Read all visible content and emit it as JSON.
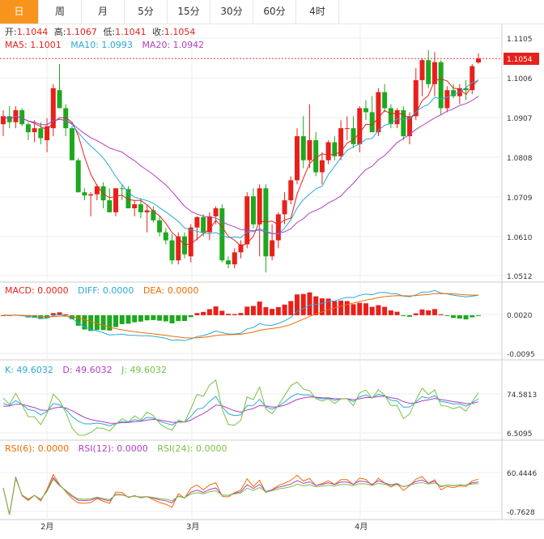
{
  "tabs": [
    {
      "label": "日",
      "active": true
    },
    {
      "label": "周",
      "active": false
    },
    {
      "label": "月",
      "active": false
    },
    {
      "label": "5分",
      "active": false
    },
    {
      "label": "15分",
      "active": false
    },
    {
      "label": "30分",
      "active": false
    },
    {
      "label": "60分",
      "active": false
    },
    {
      "label": "4时",
      "active": false
    }
  ],
  "colors": {
    "up": "#e8201c",
    "down": "#1ea81e",
    "accent": "#f7941d",
    "ma5": "#e8201c",
    "ma10": "#2aa9d8",
    "ma20": "#b23fc0",
    "dea": "#f26b00",
    "k": "#2aa9d8",
    "d": "#b23fc0",
    "j": "#7ac143",
    "rsi6": "#f26b00",
    "rsi12": "#b23fc0",
    "rsi24": "#7ac143",
    "last_price": "#e8201c"
  },
  "chart_data": {
    "type": "candlestick",
    "x_labels": [
      "2月",
      "3月",
      "4月"
    ],
    "info_ohlc": {
      "open_label": "开:",
      "open": "1.1044",
      "high_label": "高:",
      "high": "1.1067",
      "low_label": "低:",
      "low": "1.1041",
      "close_label": "收:",
      "close": "1.1054"
    },
    "ma_legend": [
      {
        "label": "MA5: 1.1001",
        "color": "#e8201c"
      },
      {
        "label": "MA10: 1.0993",
        "color": "#2aa9d8"
      },
      {
        "label": "MA20: 1.0942",
        "color": "#b23fc0"
      }
    ],
    "price_axis": {
      "ticks": [
        "1.1105",
        "1.1006",
        "1.0907",
        "1.0808",
        "1.0709",
        "1.0610",
        "1.0512"
      ],
      "range": [
        1.0512,
        1.1105
      ],
      "last_price": "1.1054"
    },
    "candles": [
      [
        1.089,
        1.0925,
        1.086,
        1.091
      ],
      [
        1.091,
        1.0935,
        1.088,
        1.0895
      ],
      [
        1.0895,
        1.0935,
        1.088,
        1.0925
      ],
      [
        1.0925,
        1.093,
        1.0885,
        1.089
      ],
      [
        1.089,
        1.0895,
        1.085,
        1.087
      ],
      [
        1.087,
        1.09,
        1.0845,
        1.088
      ],
      [
        1.088,
        1.0895,
        1.084,
        1.0855
      ],
      [
        1.085,
        1.0905,
        1.082,
        1.0885
      ],
      [
        1.088,
        1.099,
        1.086,
        1.098
      ],
      [
        1.0975,
        1.104,
        1.093,
        1.093
      ],
      [
        1.093,
        1.094,
        1.086,
        1.088
      ],
      [
        1.088,
        1.0885,
        1.08,
        1.08
      ],
      [
        1.08,
        1.0805,
        1.072,
        1.072
      ],
      [
        1.072,
        1.073,
        1.07,
        1.0712
      ],
      [
        1.0712,
        1.072,
        1.066,
        1.0715
      ],
      [
        1.0715,
        1.074,
        1.07,
        1.0735
      ],
      [
        1.0735,
        1.0745,
        1.068,
        1.07
      ],
      [
        1.07,
        1.073,
        1.067,
        1.067
      ],
      [
        1.067,
        1.073,
        1.066,
        1.073
      ],
      [
        1.073,
        1.074,
        1.07,
        1.0728
      ],
      [
        1.0728,
        1.0735,
        1.068,
        1.068
      ],
      [
        1.068,
        1.07,
        1.066,
        1.069
      ],
      [
        1.069,
        1.0705,
        1.0655,
        1.067
      ],
      [
        1.067,
        1.069,
        1.062,
        1.0675
      ],
      [
        1.0675,
        1.0685,
        1.0645,
        1.065
      ],
      [
        1.065,
        1.066,
        1.061,
        1.062
      ],
      [
        1.062,
        1.063,
        1.059,
        1.06
      ],
      [
        1.06,
        1.0615,
        1.054,
        1.055
      ],
      [
        1.055,
        1.062,
        1.054,
        1.061
      ],
      [
        1.061,
        1.062,
        1.0555,
        1.0565
      ],
      [
        1.056,
        1.064,
        1.0545,
        1.0632
      ],
      [
        1.0632,
        1.066,
        1.06,
        1.0658
      ],
      [
        1.0658,
        1.0665,
        1.061,
        1.062
      ],
      [
        1.062,
        1.067,
        1.06,
        1.066
      ],
      [
        1.066,
        1.0685,
        1.064,
        1.068
      ],
      [
        1.068,
        1.069,
        1.0545,
        1.055
      ],
      [
        1.055,
        1.056,
        1.053,
        1.054
      ],
      [
        1.054,
        1.058,
        1.053,
        1.057
      ],
      [
        1.057,
        1.06,
        1.0555,
        1.059
      ],
      [
        1.059,
        1.072,
        1.058,
        1.071
      ],
      [
        1.071,
        1.073,
        1.063,
        1.064
      ],
      [
        1.064,
        1.074,
        1.056,
        1.073
      ],
      [
        1.073,
        1.074,
        1.052,
        1.056
      ],
      [
        1.056,
        1.064,
        1.055,
        1.06
      ],
      [
        1.06,
        1.067,
        1.058,
        1.0665
      ],
      [
        1.0665,
        1.072,
        1.064,
        1.07
      ],
      [
        1.07,
        1.076,
        1.069,
        1.075
      ],
      [
        1.075,
        1.088,
        1.074,
        1.086
      ],
      [
        1.086,
        1.091,
        1.078,
        1.08
      ],
      [
        1.08,
        1.094,
        1.078,
        1.085
      ],
      [
        1.085,
        1.087,
        1.076,
        1.077
      ],
      [
        1.077,
        1.082,
        1.074,
        1.08
      ],
      [
        1.08,
        1.085,
        1.079,
        1.0845
      ],
      [
        1.0845,
        1.086,
        1.08,
        1.081
      ],
      [
        1.081,
        1.09,
        1.08,
        1.088
      ],
      [
        1.088,
        1.091,
        1.085,
        1.088
      ],
      [
        1.088,
        1.091,
        1.083,
        1.084
      ],
      [
        1.084,
        1.0935,
        1.082,
        1.093
      ],
      [
        1.093,
        1.095,
        1.09,
        1.092
      ],
      [
        1.092,
        1.096,
        1.087,
        1.087
      ],
      [
        1.087,
        1.098,
        1.086,
        1.097
      ],
      [
        1.097,
        1.099,
        1.092,
        1.093
      ],
      [
        1.093,
        1.094,
        1.088,
        1.089
      ],
      [
        1.089,
        1.093,
        1.088,
        1.0925
      ],
      [
        1.0925,
        1.0935,
        1.085,
        1.086
      ],
      [
        1.086,
        1.092,
        1.084,
        1.091
      ],
      [
        1.091,
        1.103,
        1.09,
        1.1
      ],
      [
        1.1,
        1.1055,
        1.096,
        1.105
      ],
      [
        1.105,
        1.1075,
        1.098,
        1.099
      ],
      [
        1.099,
        1.107,
        1.096,
        1.1045
      ],
      [
        1.1045,
        1.105,
        1.0915,
        1.093
      ],
      [
        1.093,
        1.0985,
        1.092,
        1.0975
      ],
      [
        1.0975,
        1.099,
        1.0955,
        1.096
      ],
      [
        1.096,
        1.099,
        1.094,
        1.098
      ],
      [
        1.098,
        1.1,
        1.095,
        1.0975
      ],
      [
        1.0975,
        1.104,
        1.0965,
        1.1035
      ],
      [
        1.1044,
        1.1067,
        1.1041,
        1.1054
      ]
    ],
    "macd": {
      "legend": [
        {
          "label": "MACD: 0.0000",
          "color": "#e8201c"
        },
        {
          "label": "DIFF: 0.0000",
          "color": "#2aa9d8"
        },
        {
          "label": "DEA: 0.0000",
          "color": "#f26b00"
        }
      ],
      "ticks": [
        "0.0020",
        "-0.0095"
      ],
      "range": [
        -0.012,
        0.0045
      ]
    },
    "kdj": {
      "legend": [
        {
          "label": "K: 49.6032",
          "color": "#2aa9d8"
        },
        {
          "label": "D: 49.6032",
          "color": "#b23fc0"
        },
        {
          "label": "J: 49.6032",
          "color": "#7ac143"
        }
      ],
      "ticks": [
        "74.5813",
        "6.5095"
      ]
    },
    "rsi": {
      "legend": [
        {
          "label": "RSI(6): 0.0000",
          "color": "#f26b00"
        },
        {
          "label": "RSI(12): 0.0000",
          "color": "#b23fc0"
        },
        {
          "label": "RSI(24): 0.0000",
          "color": "#7ac143"
        }
      ],
      "ticks": [
        "60.4446",
        "-0.7628"
      ]
    }
  }
}
